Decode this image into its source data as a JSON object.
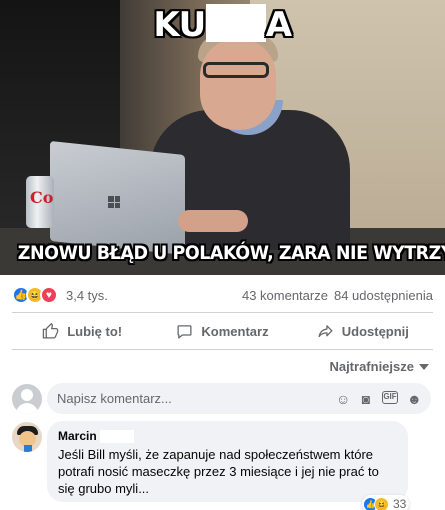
{
  "meme": {
    "top_text_start": "KU",
    "top_text_end": "A",
    "bottom_text": "ZNOWU BŁĄD U POLAKÓW, ZARA NIE WYTRZYMIE",
    "can_label": "Co"
  },
  "reactions": {
    "icons": [
      "like-icon",
      "haha-icon",
      "love-icon"
    ],
    "count": "3,4 tys.",
    "comments": "43 komentarze",
    "shares": "84 udostępnienia"
  },
  "actions": {
    "like": "Lubię to!",
    "comment": "Komentarz",
    "share": "Udostępnij"
  },
  "sort": {
    "label": "Najtrafniejsze"
  },
  "composer": {
    "placeholder": "Napisz komentarz..."
  },
  "comment": {
    "author": "Marcin",
    "text": "Jeśli Bill myśli, że zapanuje nad społeczeństwem które potrafi nosić maseczkę przez 3 miesiące i jej nie prać to się grubo myli...",
    "reaction_count": "33"
  },
  "colors": {
    "accent": "#1877f2",
    "muted_text": "#65676b",
    "bubble_bg": "#f0f2f5",
    "love": "#f33e58",
    "haha": "#f7b928"
  }
}
